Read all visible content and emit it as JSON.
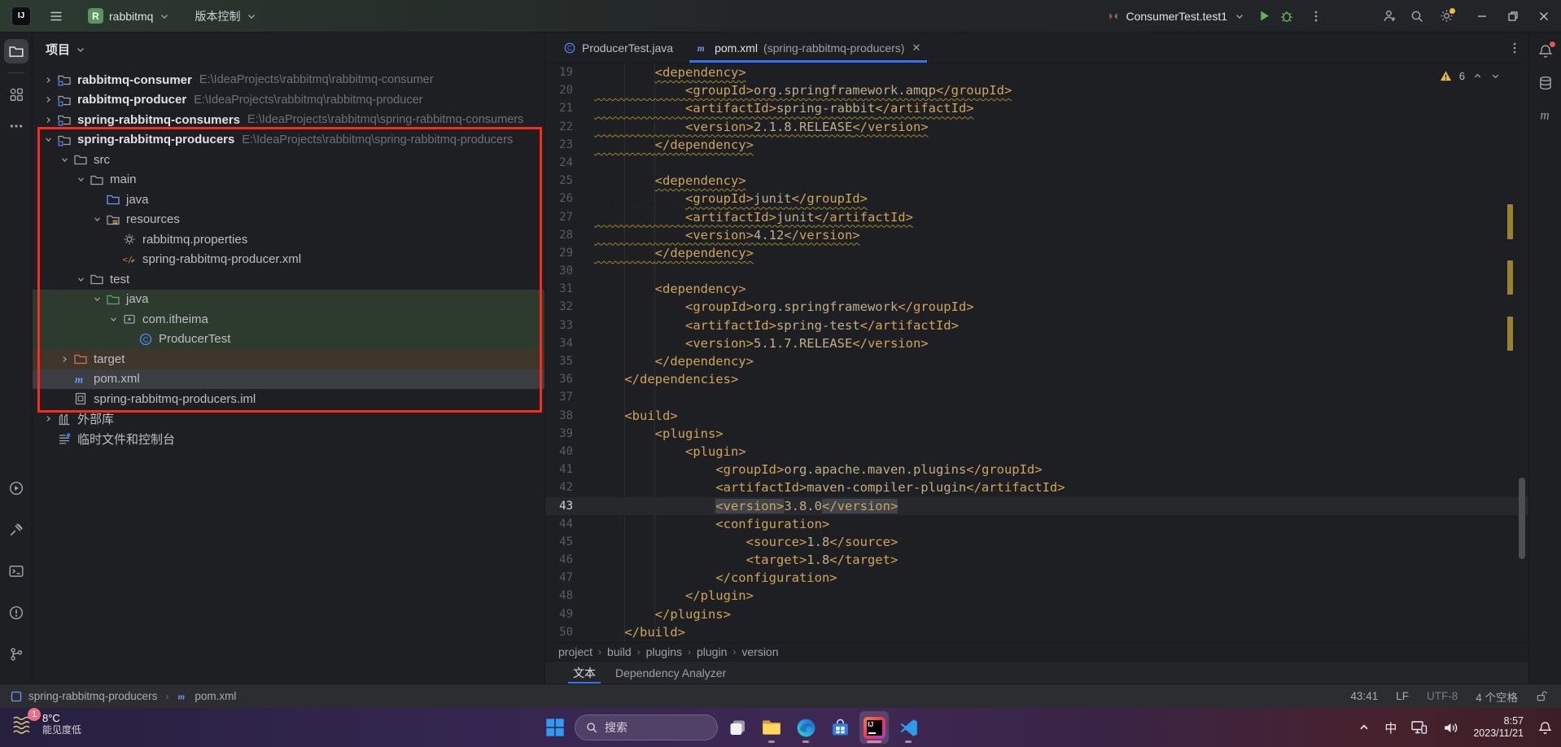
{
  "colors": {
    "accent": "#3574f0",
    "annotation": "#fb2a1f",
    "warning_underline": "#9d8928",
    "tag": "#d1a458",
    "green_row": "#2c3b2e",
    "excluded_row": "#3f362b"
  },
  "title_bar": {
    "project_name": "rabbitmq",
    "vcs_label": "版本控制",
    "run_config": "ConsumerTest.test1"
  },
  "project_panel": {
    "header": "项目",
    "items": [
      {
        "depth": 0,
        "chevron": "r",
        "icon": "module_folder",
        "label": "rabbitmq-consumer",
        "bold": true,
        "path": "E:\\IdeaProjects\\rabbitmq\\rabbitmq-consumer"
      },
      {
        "depth": 0,
        "chevron": "r",
        "icon": "module_folder",
        "label": "rabbitmq-producer",
        "bold": true,
        "path": "E:\\IdeaProjects\\rabbitmq\\rabbitmq-producer"
      },
      {
        "depth": 0,
        "chevron": "r",
        "icon": "module_folder",
        "label": "spring-rabbitmq-consumers",
        "bold": true,
        "path": "E:\\IdeaProjects\\rabbitmq\\spring-rabbitmq-consumers"
      },
      {
        "depth": 0,
        "chevron": "d",
        "icon": "module_folder",
        "label": "spring-rabbitmq-producers",
        "bold": true,
        "path": "E:\\IdeaProjects\\rabbitmq\\spring-rabbitmq-producers"
      },
      {
        "depth": 1,
        "chevron": "d",
        "icon": "folder",
        "label": "src"
      },
      {
        "depth": 2,
        "chevron": "d",
        "icon": "folder",
        "label": "main"
      },
      {
        "depth": 3,
        "chevron": "",
        "icon": "folder_blue",
        "label": "java"
      },
      {
        "depth": 3,
        "chevron": "d",
        "icon": "folder_resources",
        "label": "resources"
      },
      {
        "depth": 4,
        "chevron": "",
        "icon": "file_gear",
        "label": "rabbitmq.properties"
      },
      {
        "depth": 4,
        "chevron": "",
        "icon": "file_xml",
        "label": "spring-rabbitmq-producer.xml"
      },
      {
        "depth": 2,
        "chevron": "d",
        "icon": "folder",
        "label": "test"
      },
      {
        "depth": 3,
        "chevron": "d",
        "icon": "folder_green",
        "label": "java",
        "bg": "green"
      },
      {
        "depth": 4,
        "chevron": "d",
        "icon": "package",
        "label": "com.itheima",
        "bg": "green"
      },
      {
        "depth": 5,
        "chevron": "",
        "icon": "class",
        "label": "ProducerTest",
        "bg": "green"
      },
      {
        "depth": 1,
        "chevron": "r",
        "icon": "folder_excluded",
        "label": "target",
        "bg": "brown"
      },
      {
        "depth": 1,
        "chevron": "",
        "icon": "maven",
        "label": "pom.xml",
        "bg": "selected"
      },
      {
        "depth": 1,
        "chevron": "",
        "icon": "file_iml",
        "label": "spring-rabbitmq-producers.iml"
      },
      {
        "depth": 0,
        "chevron": "r",
        "icon": "library",
        "label": "外部库"
      },
      {
        "depth": 0,
        "chevron": "",
        "icon": "scratches",
        "label": "临时文件和控制台"
      }
    ],
    "annotation": {
      "start_index": 3,
      "end_index": 16,
      "color": "#fb2a1f"
    }
  },
  "editor": {
    "tabs": [
      {
        "icon": "class",
        "label": "ProducerTest.java",
        "suffix": "",
        "active": false
      },
      {
        "icon": "maven",
        "label": "pom.xml",
        "suffix": " (spring-rabbitmq-producers)",
        "active": true
      }
    ],
    "inspection": {
      "warnings": 6
    },
    "lines": [
      {
        "n": 19,
        "t": "        <dependency>",
        "w": 1
      },
      {
        "n": 20,
        "t": "            <groupId>org.springframework.amqp</groupId>",
        "w": 2
      },
      {
        "n": 21,
        "t": "            <artifactId>spring-rabbit</artifactId>",
        "w": 2
      },
      {
        "n": 22,
        "t": "            <version>2.1.8.RELEASE</version>",
        "w": 2
      },
      {
        "n": 23,
        "t": "        </dependency>",
        "w": 2
      },
      {
        "n": 24,
        "t": "",
        "w": 0
      },
      {
        "n": 25,
        "t": "        <dependency>",
        "w": 1
      },
      {
        "n": 26,
        "t": "            <groupId>junit</groupId>",
        "w": 2
      },
      {
        "n": 27,
        "t": "            <artifactId>junit</artifactId>",
        "w": 2
      },
      {
        "n": 28,
        "t": "            <version>4.12</version>",
        "w": 2
      },
      {
        "n": 29,
        "t": "        </dependency>",
        "w": 2
      },
      {
        "n": 30,
        "t": "",
        "w": 0
      },
      {
        "n": 31,
        "t": "        <dependency>",
        "w": 0
      },
      {
        "n": 32,
        "t": "            <groupId>org.springframework</groupId>",
        "w": 0
      },
      {
        "n": 33,
        "t": "            <artifactId>spring-test</artifactId>",
        "w": 0
      },
      {
        "n": 34,
        "t": "            <version>5.1.7.RELEASE</version>",
        "w": 0
      },
      {
        "n": 35,
        "t": "        </dependency>",
        "w": 0
      },
      {
        "n": 36,
        "t": "    </dependencies>",
        "w": 0
      },
      {
        "n": 37,
        "t": "",
        "w": 0
      },
      {
        "n": 38,
        "t": "    <build>",
        "w": 0
      },
      {
        "n": 39,
        "t": "        <plugins>",
        "w": 0
      },
      {
        "n": 40,
        "t": "            <plugin>",
        "w": 0
      },
      {
        "n": 41,
        "t": "                <groupId>org.apache.maven.plugins</groupId>",
        "w": 0
      },
      {
        "n": 42,
        "t": "                <artifactId>maven-compiler-plugin</artifactId>",
        "w": 0
      },
      {
        "n": 43,
        "t": "                <version>3.8.0</version>",
        "w": 0,
        "cur": true,
        "mark": true
      },
      {
        "n": 44,
        "t": "                <configuration>",
        "w": 0
      },
      {
        "n": 45,
        "t": "                    <source>1.8</source>",
        "w": 0
      },
      {
        "n": 46,
        "t": "                    <target>1.8</target>",
        "w": 0
      },
      {
        "n": 47,
        "t": "                </configuration>",
        "w": 0
      },
      {
        "n": 48,
        "t": "            </plugin>",
        "w": 0
      },
      {
        "n": 49,
        "t": "        </plugins>",
        "w": 0
      },
      {
        "n": 50,
        "t": "    </build>",
        "w": 0
      }
    ],
    "breadcrumbs": [
      "project",
      "build",
      "plugins",
      "plugin",
      "version"
    ]
  },
  "bottom_tabs": [
    {
      "label": "文本",
      "active": true
    },
    {
      "label": "Dependency Analyzer",
      "active": false
    }
  ],
  "status_bar": {
    "module": "spring-rabbitmq-producers",
    "file": "pom.xml",
    "caret": "43:41",
    "line_ending": "LF",
    "encoding": "UTF-8",
    "indent": "4 个空格"
  },
  "taskbar": {
    "weather": {
      "badge": "1",
      "temp": "8°C",
      "desc": "能见度低"
    },
    "search_placeholder": "搜索",
    "tray": {
      "ime": "中",
      "time": "8:57",
      "date": "2023/11/21"
    }
  }
}
